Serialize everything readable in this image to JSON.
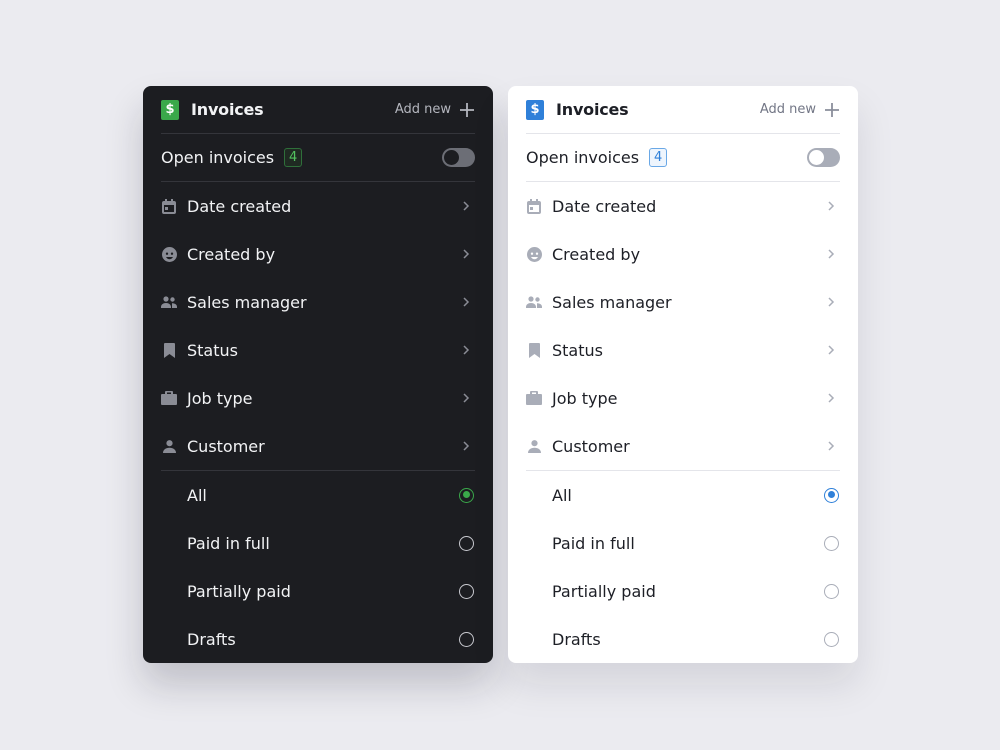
{
  "panels": [
    {
      "theme": "dark",
      "accent": "#3aa84a",
      "header": {
        "logo_glyph": "$",
        "title": "Invoices",
        "add_new_label": "Add new"
      },
      "open_invoices": {
        "label": "Open invoices",
        "count": "4",
        "toggle_on": false
      },
      "filters": [
        {
          "label": "Date created",
          "icon": "calendar-icon"
        },
        {
          "label": "Created by",
          "icon": "user-face-icon"
        },
        {
          "label": "Sales manager",
          "icon": "people-icon"
        },
        {
          "label": "Status",
          "icon": "bookmark-icon"
        },
        {
          "label": "Job type",
          "icon": "briefcase-icon"
        },
        {
          "label": "Customer",
          "icon": "person-icon"
        }
      ],
      "options": [
        {
          "label": "All",
          "selected": true
        },
        {
          "label": "Paid in full",
          "selected": false
        },
        {
          "label": "Partially paid",
          "selected": false
        },
        {
          "label": "Drafts",
          "selected": false
        }
      ]
    },
    {
      "theme": "light",
      "accent": "#2f80d9",
      "header": {
        "logo_glyph": "$",
        "title": "Invoices",
        "add_new_label": "Add new"
      },
      "open_invoices": {
        "label": "Open invoices",
        "count": "4",
        "toggle_on": false
      },
      "filters": [
        {
          "label": "Date created",
          "icon": "calendar-icon"
        },
        {
          "label": "Created by",
          "icon": "user-face-icon"
        },
        {
          "label": "Sales manager",
          "icon": "people-icon"
        },
        {
          "label": "Status",
          "icon": "bookmark-icon"
        },
        {
          "label": "Job type",
          "icon": "briefcase-icon"
        },
        {
          "label": "Customer",
          "icon": "person-icon"
        }
      ],
      "options": [
        {
          "label": "All",
          "selected": true
        },
        {
          "label": "Paid in full",
          "selected": false
        },
        {
          "label": "Partially paid",
          "selected": false
        },
        {
          "label": "Drafts",
          "selected": false
        }
      ]
    }
  ]
}
